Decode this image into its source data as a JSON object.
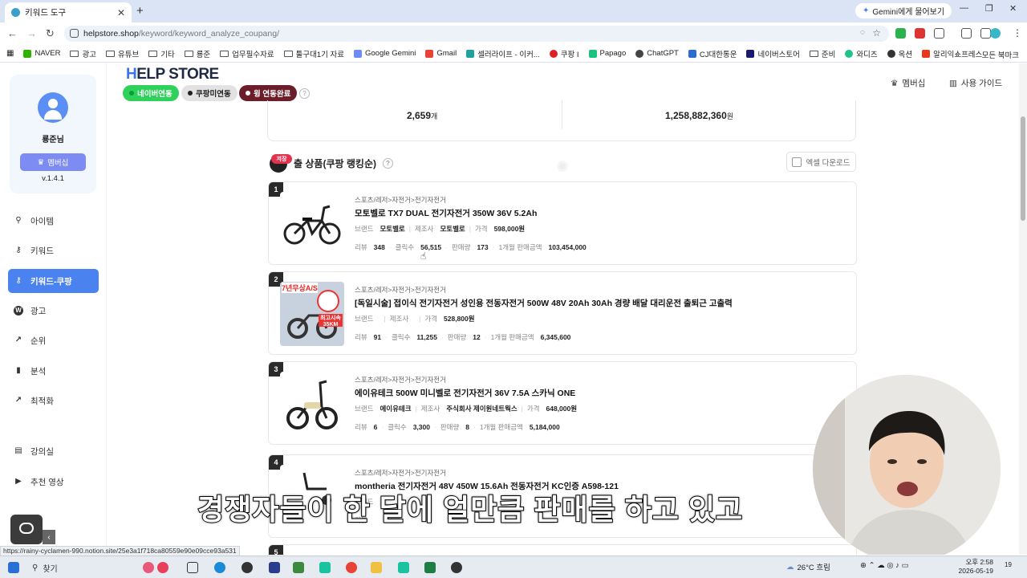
{
  "browser": {
    "tab_title": "키워드 도구",
    "gemini_button": "Gemini에게 물어보기",
    "url_host": "helpstore.shop",
    "url_path": "/keyword/keyword_analyze_coupang/",
    "bookmarks": [
      "NAVER",
      "광고",
      "유튜브",
      "기타",
      "룡준",
      "업무필수자료",
      "툴구대1기 자료",
      "Google Gemini",
      "Gmail",
      "셀러라이프 - 이커...",
      "쿠팡 I",
      "Papago",
      "ChatGPT",
      "CJ대한통운",
      "네이버스토어",
      "준비",
      "와디즈",
      "옥션",
      "알리익스프레스"
    ],
    "bookmarks_all": "모든 북마크",
    "status_url": "https://rainy-cyclamen-990.notion.site/25e3a1f718ca80559e90e09cce93a531"
  },
  "sidebar": {
    "user_name": "룡준님",
    "membership_button": "멤버십",
    "version": "v.1.4.1",
    "items": [
      {
        "label": "아이템",
        "icon": "search-icon"
      },
      {
        "label": "키워드",
        "icon": "key-icon"
      },
      {
        "label": "키워드-쿠팡",
        "icon": "key-icon",
        "active": true
      },
      {
        "label": "광고",
        "icon": "w-icon"
      },
      {
        "label": "순위",
        "icon": "trend-icon"
      },
      {
        "label": "분석",
        "icon": "bar-chart-icon"
      },
      {
        "label": "최적화",
        "icon": "trend-icon"
      },
      {
        "label": "강의실",
        "icon": "document-icon"
      },
      {
        "label": "추천 영상",
        "icon": "play-icon"
      }
    ]
  },
  "header": {
    "logo": "HELP STORE",
    "logo_accent": "H",
    "logo_rest": "ELP STORE",
    "status_pills": [
      {
        "label": "네이버연동",
        "dot": "#0a9b3c",
        "bg": "#2ed15a",
        "color": "#ffffff"
      },
      {
        "label": "쿠팡미연동",
        "dot": "#222222",
        "bg": "#e2e2e2",
        "color": "#222222"
      },
      {
        "label": "윙 연동완료",
        "dot": "#ffffff",
        "bg": "#6b1d2a",
        "color": "#ffffff"
      }
    ],
    "membership_link": "멤버십",
    "guide_link": "사용 가이드"
  },
  "stats": {
    "count_value": "2,659",
    "count_unit": "개",
    "amount_value": "1,258,882,360",
    "amount_unit": "원"
  },
  "section": {
    "title": "출 상품(쿠팡 랭킹순)",
    "save_badge": "저장",
    "excel_button": "엑셀 다운로드"
  },
  "products": [
    {
      "rank": "1",
      "category": "스포츠/레저>자전거>전기자전거",
      "title": "모토벨로 TX7 DUAL 전기자전거 350W 36V 5.2Ah",
      "brand": "모토벨로",
      "maker": "모토벨로",
      "price": "598,000원",
      "reviews": "348",
      "clicks": "56,515",
      "sales": "173",
      "monthly": "103,454,000"
    },
    {
      "rank": "2",
      "category": "스포츠/레저>자전거>전기자전거",
      "title": "[독일시술] 접이식 전기자전거 성인용 전동자전거 500W 48V 20Ah 30Ah 경량 배달 대리운전 출퇴근 고출력",
      "brand": "",
      "maker": "",
      "price": "528,800원",
      "reviews": "91",
      "clicks": "11,255",
      "sales": "12",
      "monthly": "6,345,600",
      "thumb_top": "7년무상A/S",
      "thumb_badge": "최고시속 35KM"
    },
    {
      "rank": "3",
      "category": "스포츠/레저>자전거>전기자전거",
      "title": "에이유테크 500W 미니벨로 전기자전거 36V 7.5A 스카닉 ONE",
      "brand": "에이유테크",
      "maker": "주식회사 제이원네트웍스",
      "price": "648,000원",
      "reviews": "6",
      "clicks": "3,300",
      "sales": "8",
      "monthly": "5,184,000"
    },
    {
      "rank": "4",
      "category": "스포츠/레저>자전거>전기자전거",
      "title": "montheria 전기자전거 48V 450W 15.6Ah 전동자전거 KC인증 A598-121",
      "brand": "",
      "maker": "",
      "price": "",
      "reviews": "",
      "clicks": "",
      "sales": "",
      "monthly": ""
    },
    {
      "rank": "5"
    }
  ],
  "labels": {
    "brand": "브랜드",
    "maker": "제조사",
    "price": "가격",
    "reviews": "리뷰",
    "clicks": "클릭수",
    "sales": "판매량",
    "monthly": "1개월 판매금액"
  },
  "subtitle": "경쟁자들이 한 달에 얼만큼 판매를 하고 있고",
  "taskbar": {
    "search": "찾기",
    "weather": "26°C  흐림",
    "time_ampm": "오후 2:58",
    "date": "2026-05-19",
    "notif": "19"
  }
}
